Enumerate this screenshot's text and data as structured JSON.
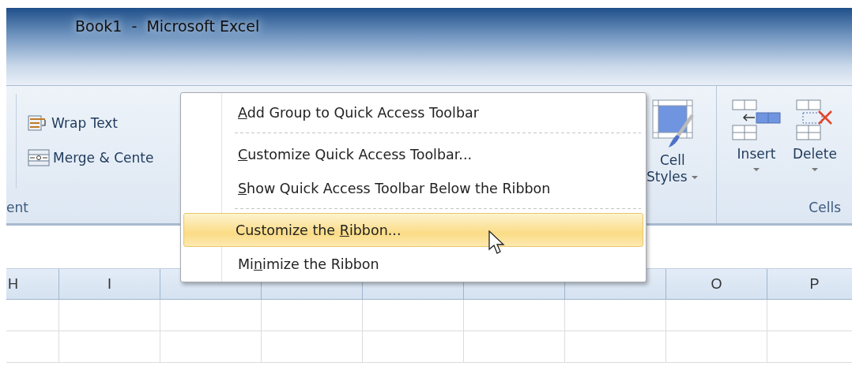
{
  "window": {
    "title": "Book1  -  Microsoft Excel"
  },
  "ribbon": {
    "alignment_group": {
      "label": "ent",
      "buttons": [
        {
          "label": "Wrap Text",
          "kind": "wrap"
        },
        {
          "label": "Merge & Cente",
          "kind": "merge"
        }
      ]
    },
    "styles_group": {
      "buttons": [
        {
          "label_lines": [
            "Cell",
            "Styles"
          ],
          "kind": "cell_styles",
          "dropdown": true
        }
      ]
    },
    "cells_group": {
      "label": "Cells",
      "buttons": [
        {
          "label": "Insert",
          "kind": "insert",
          "dropdown": true
        },
        {
          "label": "Delete",
          "kind": "delete",
          "dropdown": true
        }
      ]
    }
  },
  "context_menu": {
    "items": [
      {
        "access_key": "A",
        "label_after": "dd Group to Quick Access Toolbar",
        "selected": false,
        "separator_after": true
      },
      {
        "access_key": "C",
        "label_after": "ustomize Quick Access Toolbar...",
        "selected": false,
        "separator_after": false
      },
      {
        "access_key": "S",
        "label_after": "how Quick Access Toolbar Below the Ribbon",
        "selected": false,
        "separator_after": true
      },
      {
        "label_before": "Customize the ",
        "access_key": "R",
        "label_after": "ibbon...",
        "selected": true,
        "separator_after": false
      },
      {
        "label_before": "Mi",
        "access_key": "n",
        "label_after": "imize the Ribbon",
        "selected": false,
        "separator_after": false
      }
    ]
  },
  "sheet": {
    "columns_left": [
      "H",
      "I"
    ],
    "columns_right": [
      "O",
      "P"
    ]
  }
}
